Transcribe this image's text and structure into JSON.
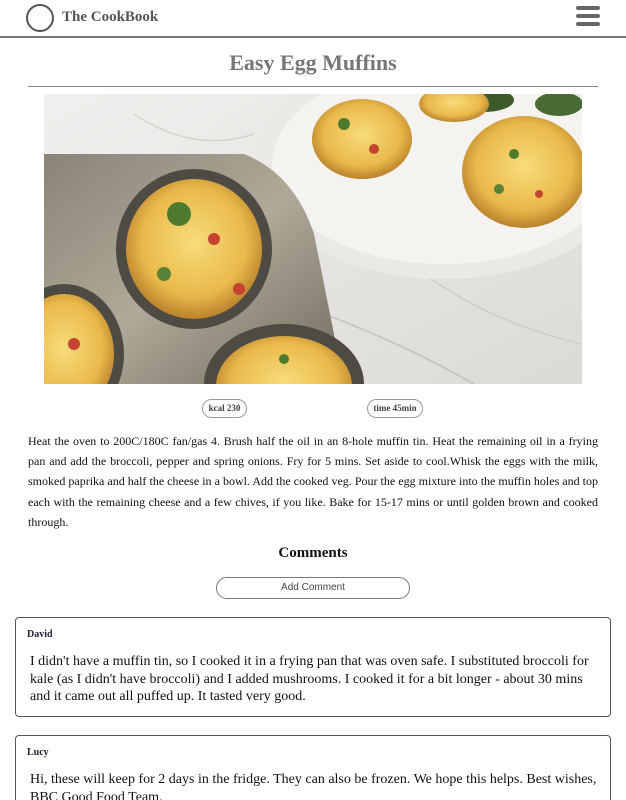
{
  "header": {
    "brand": "The CookBook",
    "logo_icon": "circle-logo-icon",
    "menu_icon": "hamburger-menu-icon"
  },
  "recipe": {
    "title": "Easy Egg Muffins",
    "image_subject": "egg-muffins-photo",
    "kcal_label": "kcal 230",
    "time_label": "time 45min",
    "description": "Heat the oven to 200C/180C fan/gas 4. Brush half the oil in an 8-hole muffin tin. Heat the remaining oil in a frying pan and add the broccoli, pepper and spring onions. Fry for 5 mins. Set aside to cool.Whisk the eggs with the milk, smoked paprika and half the cheese in a bowl. Add the cooked veg. Pour the egg mixture into the muffin holes and top each with the remaining cheese and a few chives, if you like. Bake for 15-17 mins or until golden brown and cooked through."
  },
  "comments": {
    "heading": "Comments",
    "add_button": "Add Comment",
    "items": [
      {
        "author": "David",
        "text": "I didn't have a muffin tin, so I cooked it in a frying pan that was oven safe. I substituted broccoli for kale (as I didn't have broccoli) and I added mushrooms. I cooked it for a bit longer - about 30 mins and it came out all puffed up. It tasted very good."
      },
      {
        "author": "Lucy",
        "text": "Hi, these will keep for 2 days in the fridge. They can also be frozen. We hope this helps. Best wishes, BBC Good Food Team."
      }
    ]
  }
}
